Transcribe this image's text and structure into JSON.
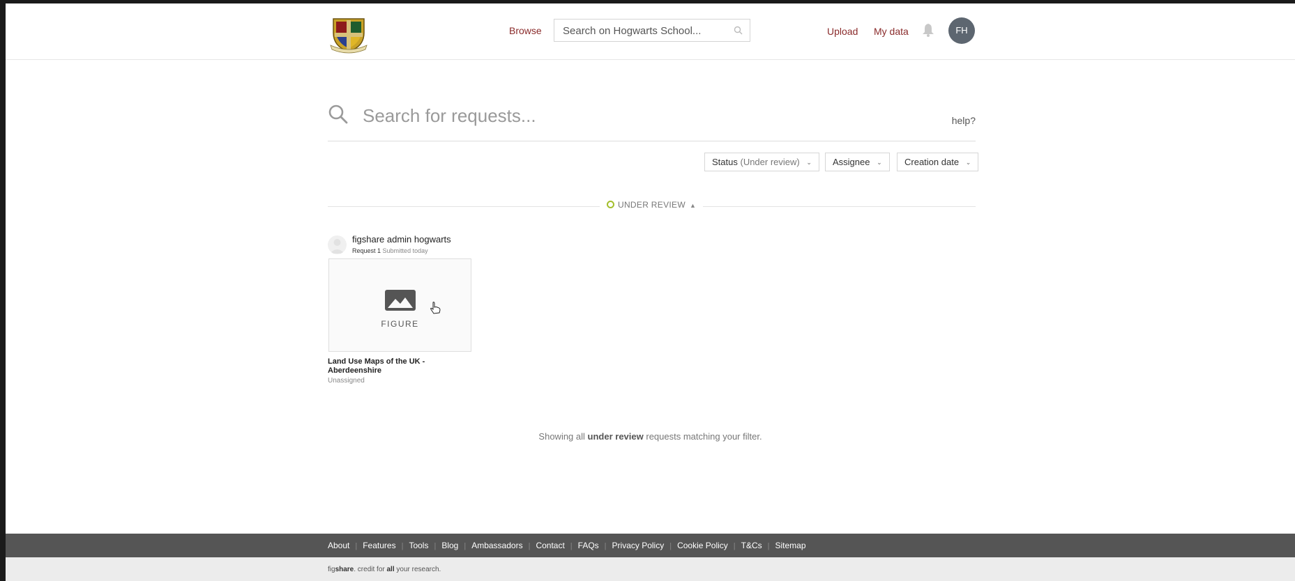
{
  "header": {
    "browse": "Browse",
    "search_placeholder": "Search on Hogwarts School...",
    "upload": "Upload",
    "my_data": "My data",
    "avatar_initials": "FH"
  },
  "request_search": {
    "placeholder": "Search for requests...",
    "help": "help?"
  },
  "filters": {
    "status_label": "Status",
    "status_value": "(Under review)",
    "assignee": "Assignee",
    "creation_date": "Creation date"
  },
  "section": {
    "label": "UNDER REVIEW"
  },
  "requests": [
    {
      "user": "figshare admin hogwarts",
      "request_number": "Request 1",
      "submitted": "Submitted today",
      "thumbnail_label": "FIGURE",
      "title": "Land Use Maps of the UK - Aberdeenshire",
      "assignee": "Unassigned"
    }
  ],
  "summary": {
    "prefix": "Showing all",
    "emphasis": "under review",
    "suffix": "requests matching your filter."
  },
  "footer": {
    "links": [
      "About",
      "Features",
      "Tools",
      "Blog",
      "Ambassadors",
      "Contact",
      "FAQs",
      "Privacy Policy",
      "Cookie Policy",
      "T&Cs",
      "Sitemap"
    ],
    "tagline_brand_prefix": "fig",
    "tagline_brand_bold": "share",
    "tagline_middle": ". credit for ",
    "tagline_bold": "all",
    "tagline_end": " your research."
  },
  "colors": {
    "link": "#8a2b2b",
    "status_under_review": "#a3be2b",
    "footer_dark": "#555555",
    "avatar_bg": "#5d6670"
  }
}
